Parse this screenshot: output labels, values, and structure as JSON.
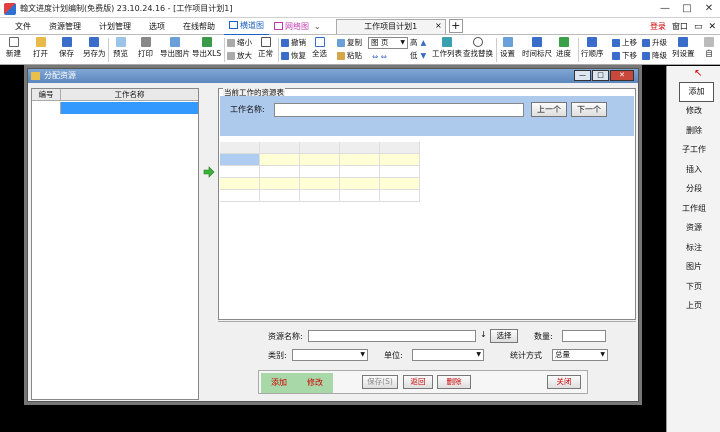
{
  "window": {
    "title": "翰文进度计划编制(免费版) 23.10.24.16 - [工作项目计划1]",
    "controls": [
      "—",
      "□",
      "✕"
    ]
  },
  "menu": {
    "items": [
      "文件",
      "资源管理",
      "计划管理",
      "选项",
      "在线帮助"
    ],
    "view_tabs": [
      "横道图",
      "网络图"
    ],
    "doc_tab": "工作项目计划1",
    "doc_tab_close": "×",
    "dropdown_arrow": "⌄",
    "new_tab": "+",
    "login": "登录",
    "window_label": "窗口",
    "restore": "▭",
    "close": "✕"
  },
  "toolbar": {
    "new": "新建",
    "open": "打开",
    "save": "保存",
    "save_as": "另存为",
    "preview": "预览",
    "print": "打印",
    "export_image": "导出图片",
    "export_xls": "导出XLS",
    "zoom_out": "缩小",
    "zoom_in": "放大",
    "normal": "正常",
    "undo": "撤销",
    "redo": "恢复",
    "select_all": "全选",
    "copy": "复制",
    "paste": "粘贴",
    "page_select": "图 页",
    "high": "高",
    "low": "低",
    "task_list": "工作列表",
    "find_replace": "查找替换",
    "settings": "设置",
    "timescale": "时间标尺",
    "progress": "进度",
    "row_order": "行顺序",
    "move_up": "上移",
    "move_down": "下移",
    "upgrade": "升级",
    "downgrade": "降级",
    "column_settings": "列设置",
    "more": "自"
  },
  "right_panel": {
    "items": [
      "添加",
      "修改",
      "删除",
      "子工作",
      "插入",
      "分段",
      "工作组",
      "资源",
      "标注",
      "图片",
      "下页",
      "上页"
    ]
  },
  "dialog": {
    "title": "分配资源",
    "buttons": [
      "—",
      "□",
      "✕"
    ],
    "left_list": {
      "col_id": "编号",
      "col_name": "工作名称"
    },
    "right_pane": {
      "group_label": "当前工作的资源表",
      "work_name_label": "工作名称:",
      "work_name_value": "",
      "prev_button": "上一个",
      "next_button": "下一个"
    },
    "lower": {
      "resource_name_label": "资源名称:",
      "resource_name_value": "",
      "down_arrow": "↓",
      "select_button": "选择",
      "quantity_label": "数量:",
      "quantity_value": "",
      "category_label": "类别:",
      "category_value": "",
      "unit_label": "单位:",
      "unit_value": "",
      "stat_label": "统计方式",
      "stat_value": "总量",
      "add_button": "添加",
      "edit_button": "修改",
      "save_button": "保存(S)",
      "return_button": "返回",
      "delete_button": "删除",
      "close_button": "关闭"
    }
  },
  "colors": {
    "selection": "#3399ff",
    "blue_bar": "#adcaec",
    "green_area": "#a8d8a8",
    "red_text": "#cc0000"
  }
}
